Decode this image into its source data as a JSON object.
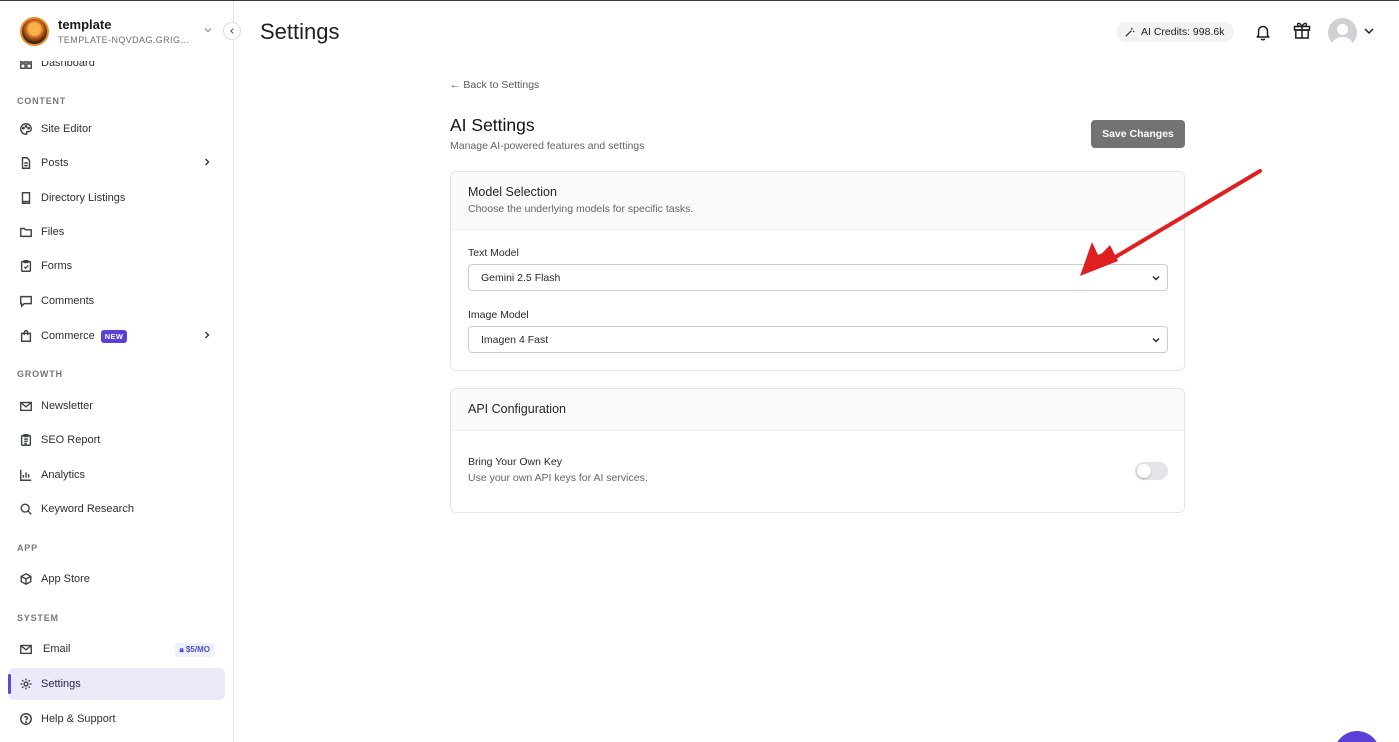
{
  "workspace": {
    "name": "template",
    "subtitle": "TEMPLATE-NQVDAG.GRIGOR..."
  },
  "sidebar": {
    "items": [
      {
        "label": "Dashboard",
        "icon": "dashboard-icon"
      },
      {
        "section": "CONTENT"
      },
      {
        "label": "Site Editor",
        "icon": "palette-icon"
      },
      {
        "label": "Posts",
        "icon": "document-icon"
      },
      {
        "label": "Directory Listings",
        "icon": "book-icon"
      },
      {
        "label": "Files",
        "icon": "folder-icon"
      },
      {
        "label": "Forms",
        "icon": "clipboard-check-icon"
      },
      {
        "label": "Comments",
        "icon": "comment-icon"
      },
      {
        "label": "Commerce",
        "icon": "shopping-bag-icon",
        "badge": "NEW"
      },
      {
        "section": "GROWTH"
      },
      {
        "label": "Newsletter",
        "icon": "mail-icon"
      },
      {
        "label": "SEO Report",
        "icon": "clipboard-list-icon"
      },
      {
        "label": "Analytics",
        "icon": "bar-chart-icon"
      },
      {
        "label": "Keyword Research",
        "icon": "search-icon"
      },
      {
        "section": "APP"
      },
      {
        "label": "App Store",
        "icon": "cube-icon"
      },
      {
        "section": "SYSTEM"
      },
      {
        "label": "Email",
        "icon": "mail-icon",
        "badge": "$5/MO"
      },
      {
        "label": "Settings",
        "icon": "gear-icon",
        "active": true
      },
      {
        "label": "Help & Support",
        "icon": "help-circle-icon"
      }
    ]
  },
  "header": {
    "title": "Settings",
    "credits": "AI Credits: 998.6k"
  },
  "main": {
    "back_link": "← Back to Settings",
    "title": "AI Settings",
    "subtitle": "Manage AI-powered features and settings",
    "save_label": "Save Changes",
    "model_card": {
      "title": "Model Selection",
      "description": "Choose the underlying models for specific tasks.",
      "text_model_label": "Text Model",
      "text_model_value": "Gemini 2.5 Flash",
      "image_model_label": "Image Model",
      "image_model_value": "Imagen 4 Fast"
    },
    "api_card": {
      "title": "API Configuration",
      "byok_label": "Bring Your Own Key",
      "byok_description": "Use your own API keys for AI services.",
      "byok_enabled": false
    }
  },
  "colors": {
    "accent": "#5b4bd6",
    "annotation_arrow": "#e02020",
    "save_button": "#737373"
  }
}
